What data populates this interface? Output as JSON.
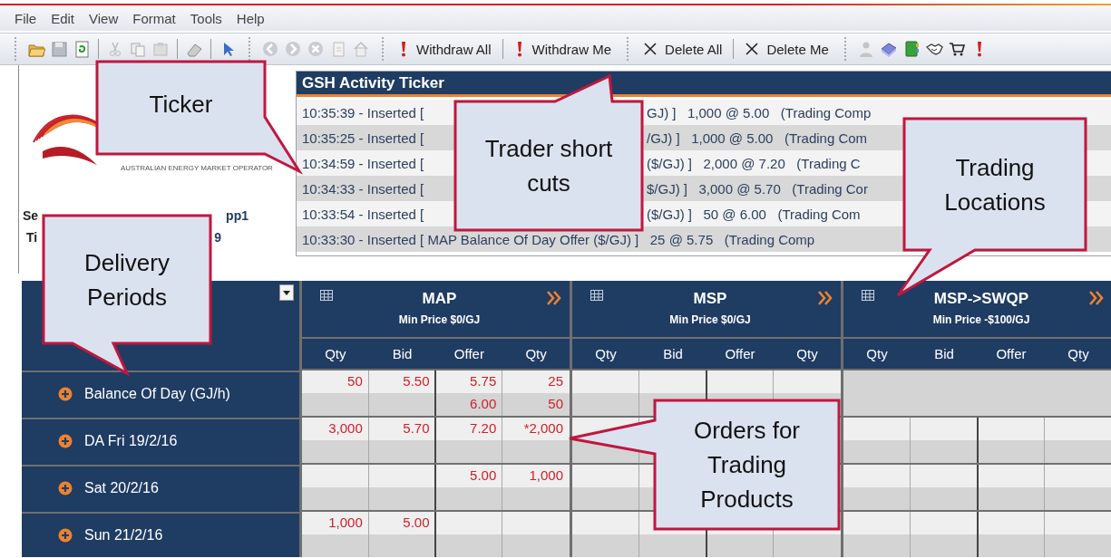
{
  "menu": [
    "File",
    "Edit",
    "View",
    "Format",
    "Tools",
    "Help"
  ],
  "toolbar": {
    "actions": [
      {
        "label": "Withdraw All",
        "kind": "withdraw"
      },
      {
        "label": "Withdraw Me",
        "kind": "withdraw"
      },
      {
        "label": "Delete All",
        "kind": "delete"
      },
      {
        "label": "Delete Me",
        "kind": "delete"
      }
    ]
  },
  "logo": {
    "tagline": "AUSTRALIAN ENERGY MARKET OPERATOR"
  },
  "session": {
    "server_label": "Se",
    "server_value": "pp1",
    "time_label": "Ti",
    "time_value": "9"
  },
  "ticker": {
    "title": "GSH Activity Ticker",
    "rows": [
      {
        "start": "10:35:39 - Inserted [",
        "rest": "GJ) ]   1,000 @ 5.00   (Trading Comp"
      },
      {
        "start": "10:35:25 - Inserted [",
        "rest": "/GJ) ]   1,000 @ 5.00   (Trading Com"
      },
      {
        "start": "10:34:59 - Inserted [",
        "rest": "($/GJ) ]   2,000 @ 7.20   (Trading C"
      },
      {
        "start": "10:34:33 - Inserted [",
        "rest": "$/GJ) ]   3,000 @ 5.70   (Trading Cor"
      },
      {
        "start": "10:33:54 - Inserted [",
        "rest": "($/GJ) ]   50 @ 6.00   (Trading Com"
      },
      {
        "start": "10:33:30 - Inserted [ MAP Balance Of Day Offer ($/GJ) ]   25 @ 5.75   (Trading Comp"
      }
    ]
  },
  "market": {
    "locations": [
      {
        "name": "MAP",
        "min_price": "Min Price $0/GJ",
        "columns": [
          "Qty",
          "Bid",
          "Offer",
          "Qty"
        ]
      },
      {
        "name": "MSP",
        "min_price": "Min Price $0/GJ",
        "columns": [
          "Qty",
          "Bid",
          "Offer",
          "Qty"
        ]
      },
      {
        "name": "MSP->SWQP",
        "min_price": "Min Price -$100/GJ",
        "columns": [
          "Qty",
          "Bid",
          "Offer",
          "Qty"
        ]
      }
    ],
    "periods": [
      {
        "label": "Balance Of Day (GJ/h)",
        "orders": [
          {
            "available": true,
            "lines": [
              {
                "qty_bid": "50",
                "bid": "5.50",
                "offer": "5.75",
                "qty_offer": "25"
              },
              {
                "offer": "6.00",
                "qty_offer": "50"
              }
            ]
          },
          {
            "available": true
          },
          {
            "available": false
          }
        ]
      },
      {
        "label": "DA Fri 19/2/16",
        "orders": [
          {
            "available": true,
            "lines": [
              {
                "qty_bid": "3,000",
                "bid": "5.70",
                "offer": "7.20",
                "qty_offer": "*2,000"
              }
            ]
          },
          {
            "available": true
          },
          {
            "available": true
          }
        ]
      },
      {
        "label": "Sat 20/2/16",
        "orders": [
          {
            "available": true,
            "lines": [
              {
                "offer": "5.00",
                "qty_offer": "1,000"
              }
            ]
          },
          {
            "available": true
          },
          {
            "available": true
          }
        ]
      },
      {
        "label": "Sun 21/2/16",
        "orders": [
          {
            "available": true,
            "lines": [
              {
                "qty_bid": "1,000",
                "bid": "5.00"
              }
            ]
          },
          {
            "available": true
          },
          {
            "available": true
          }
        ]
      }
    ]
  },
  "callouts": [
    {
      "text": "Ticker"
    },
    {
      "text": "Trader short cuts"
    },
    {
      "text": "Trading Locations"
    },
    {
      "text": "Delivery Periods"
    },
    {
      "text": "Orders for Trading Products"
    }
  ]
}
